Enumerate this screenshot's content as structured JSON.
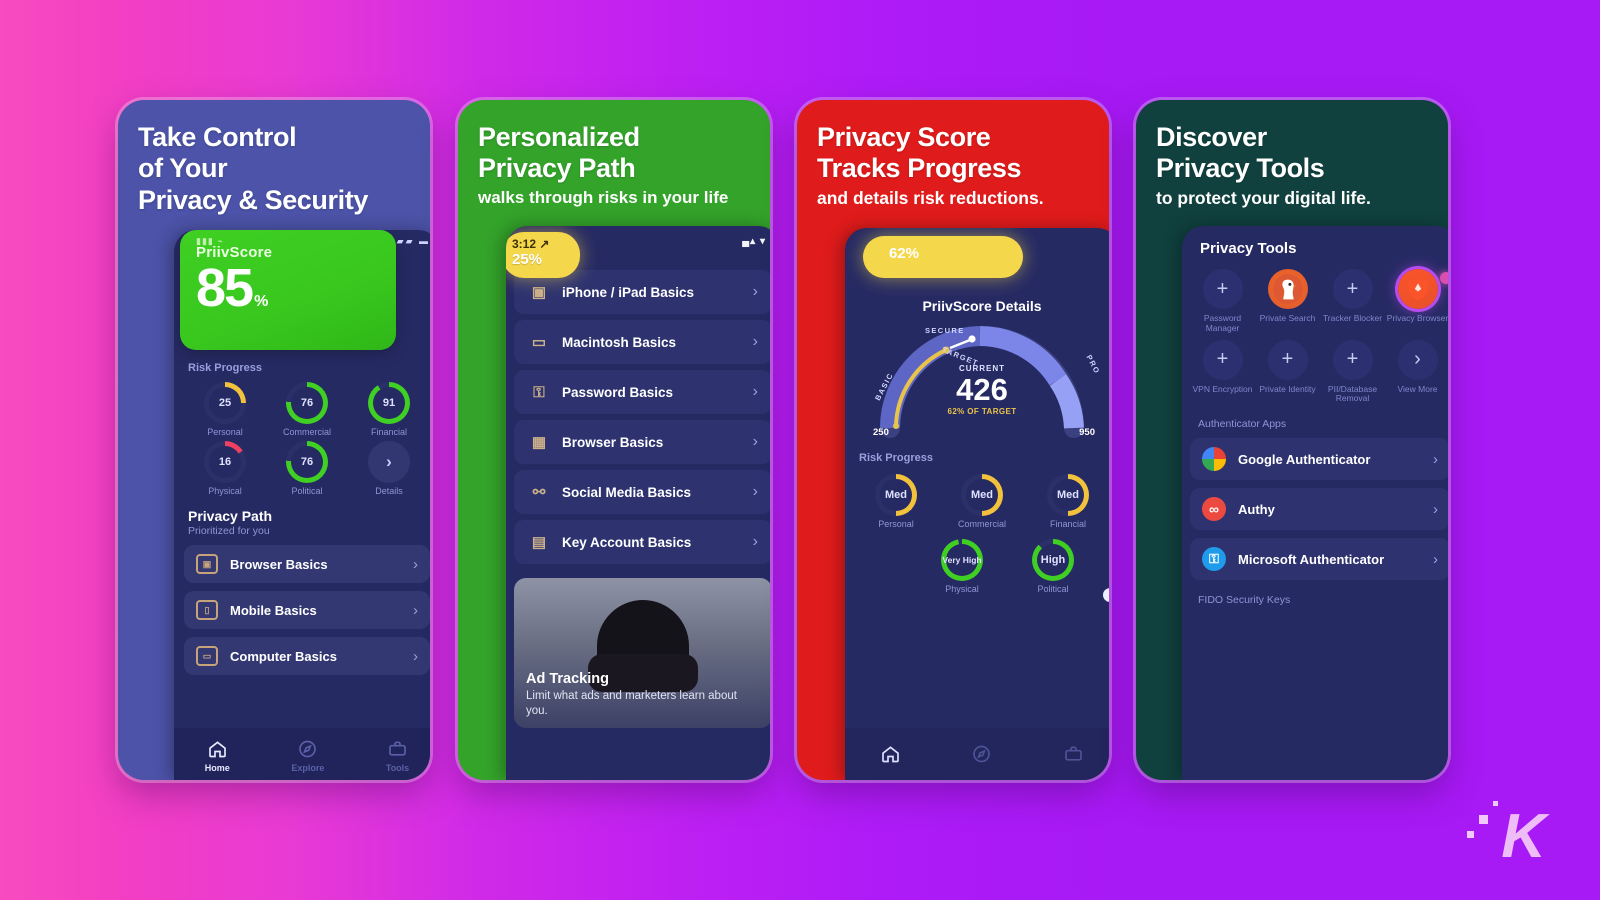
{
  "background": {
    "start_color": "#f84bbf",
    "end_color": "#a719f5"
  },
  "watermark": {
    "letter": "K"
  },
  "phones": [
    {
      "id": "take-control",
      "frame_color": "#4c53a8",
      "headline": {
        "line1": "Take Control",
        "line2": "of Your",
        "line3": "Privacy & Security",
        "sub": ""
      },
      "status": {
        "time": "",
        "signal": ""
      },
      "score_card": {
        "label": "PriivScore",
        "value": "85",
        "unit": "%",
        "color": "#3fd023"
      },
      "gear_icon": "gear-icon",
      "help_icon": "?",
      "risk_progress": {
        "title": "Risk Progress",
        "items": [
          {
            "value": "25",
            "label": "Personal",
            "color": "#f2c23c",
            "pct": 25
          },
          {
            "value": "76",
            "label": "Commercial",
            "color": "#3fd023",
            "pct": 76
          },
          {
            "value": "91",
            "label": "Financial",
            "color": "#3fd023",
            "pct": 91
          },
          {
            "value": "16",
            "label": "Physical",
            "color": "#ef4060",
            "pct": 16
          },
          {
            "value": "76",
            "label": "Political",
            "color": "#3fd023",
            "pct": 76
          }
        ],
        "details_label": "Details",
        "details_chevron": "›"
      },
      "privacy_path": {
        "title": "Privacy Path",
        "subtitle": "Prioritized for you",
        "items": [
          {
            "label": "Browser Basics",
            "icon": "browser-icon"
          },
          {
            "label": "Mobile Basics",
            "icon": "mobile-icon"
          },
          {
            "label": "Computer Basics",
            "icon": "computer-icon"
          }
        ]
      },
      "tabbar": [
        {
          "label": "Home",
          "icon": "home-icon",
          "glyph": "⌂",
          "active": true
        },
        {
          "label": "Explore",
          "icon": "compass-icon",
          "glyph": "◎",
          "active": false
        },
        {
          "label": "Tools",
          "icon": "toolbox-icon",
          "glyph": "▤",
          "active": false
        }
      ]
    },
    {
      "id": "personalized-path",
      "frame_color": "#33a32a",
      "headline": {
        "line1": "Personalized",
        "line2": "Privacy Path",
        "line3": "",
        "sub": "walks through risks in your life"
      },
      "status": {
        "time": "3:12 ↗",
        "signal": "▄▴ ▾"
      },
      "badge": {
        "time": "3:12 ↗",
        "percent": "25%",
        "color": "#f5d74b"
      },
      "list": [
        {
          "label": "iPhone / iPad Basics",
          "icon": "devices-icon",
          "glyph": "▣"
        },
        {
          "label": "Macintosh Basics",
          "icon": "laptop-icon",
          "glyph": "▭"
        },
        {
          "label": "Password Basics",
          "icon": "lock-icon",
          "glyph": "⚿"
        },
        {
          "label": "Browser Basics",
          "icon": "browser-icon",
          "glyph": "▦"
        },
        {
          "label": "Social Media Basics",
          "icon": "social-icon",
          "glyph": "⚯"
        },
        {
          "label": "Key Account Basics",
          "icon": "key-account-icon",
          "glyph": "▤"
        }
      ],
      "ad_card": {
        "title": "Ad Tracking",
        "description": "Limit what ads and marketers learn about you."
      }
    },
    {
      "id": "privacy-score",
      "frame_color": "#e01b1b",
      "headline": {
        "line1": "Privacy Score",
        "line2": "Tracks Progress",
        "line3": "",
        "sub": "and details risk reductions."
      },
      "badge": {
        "percent": "62%",
        "color": "#f5d74b"
      },
      "gauge": {
        "title": "PriivScore Details",
        "current_label": "CURRENT",
        "current_value": "426",
        "of_target": "62% OF TARGET",
        "min": "250",
        "max": "950",
        "zones": [
          "BASIC",
          "SECURE",
          "PRO"
        ],
        "target_label": "TARGET"
      },
      "risk_progress": {
        "title": "Risk Progress",
        "items": [
          {
            "value": "Med",
            "label": "Personal",
            "color": "#f2c23c",
            "pct": 50
          },
          {
            "value": "Med",
            "label": "Commercial",
            "color": "#f2c23c",
            "pct": 50
          },
          {
            "value": "Med",
            "label": "Financial",
            "color": "#f2c23c",
            "pct": 50
          },
          {
            "value": "Very High",
            "label": "Physical",
            "color": "#3fd023",
            "pct": 97
          },
          {
            "value": "High",
            "label": "Political",
            "color": "#3fd023",
            "pct": 88
          }
        ]
      },
      "tabbar": [
        {
          "label": "",
          "icon": "home-icon",
          "glyph": "⌂",
          "active": true
        },
        {
          "label": "",
          "icon": "compass-icon",
          "glyph": "◎",
          "active": false
        },
        {
          "label": "",
          "icon": "toolbox-icon",
          "glyph": "▤",
          "active": false
        }
      ]
    },
    {
      "id": "privacy-tools",
      "frame_color": "#10413f",
      "headline": {
        "line1": "Discover",
        "line2": "Privacy Tools",
        "line3": "",
        "sub": "to protect your digital life."
      },
      "panel_title": "Privacy Tools",
      "tools": [
        {
          "label": "Password Manager",
          "icon": "plus-icon",
          "glyph": "+",
          "style": "plus"
        },
        {
          "label": "Private Search",
          "icon": "duckduckgo-icon",
          "glyph": "🦆",
          "style": "ddg"
        },
        {
          "label": "Tracker Blocker",
          "icon": "plus-icon",
          "glyph": "+",
          "style": "plus"
        },
        {
          "label": "Privacy Browser",
          "icon": "brave-icon",
          "glyph": "🦁",
          "style": "brave"
        },
        {
          "label": "VPN Encryption",
          "icon": "plus-icon",
          "glyph": "+",
          "style": "plus"
        },
        {
          "label": "Private Identity",
          "icon": "plus-icon",
          "glyph": "+",
          "style": "plus"
        },
        {
          "label": "PII/Database Removal",
          "icon": "plus-icon",
          "glyph": "+",
          "style": "plus"
        },
        {
          "label": "View More",
          "icon": "chevron-right-icon",
          "glyph": "›",
          "style": "plus"
        }
      ],
      "authenticator_section": "Authenticator Apps",
      "authenticators": [
        {
          "label": "Google Authenticator",
          "icon": "google-icon",
          "logo": "logo-g",
          "glyph": ""
        },
        {
          "label": "Authy",
          "icon": "authy-icon",
          "logo": "logo-a",
          "glyph": "∞"
        },
        {
          "label": "Microsoft Authenticator",
          "icon": "microsoft-icon",
          "logo": "logo-m",
          "glyph": "⚿"
        }
      ],
      "fido_section": "FIDO Security Keys"
    }
  ]
}
